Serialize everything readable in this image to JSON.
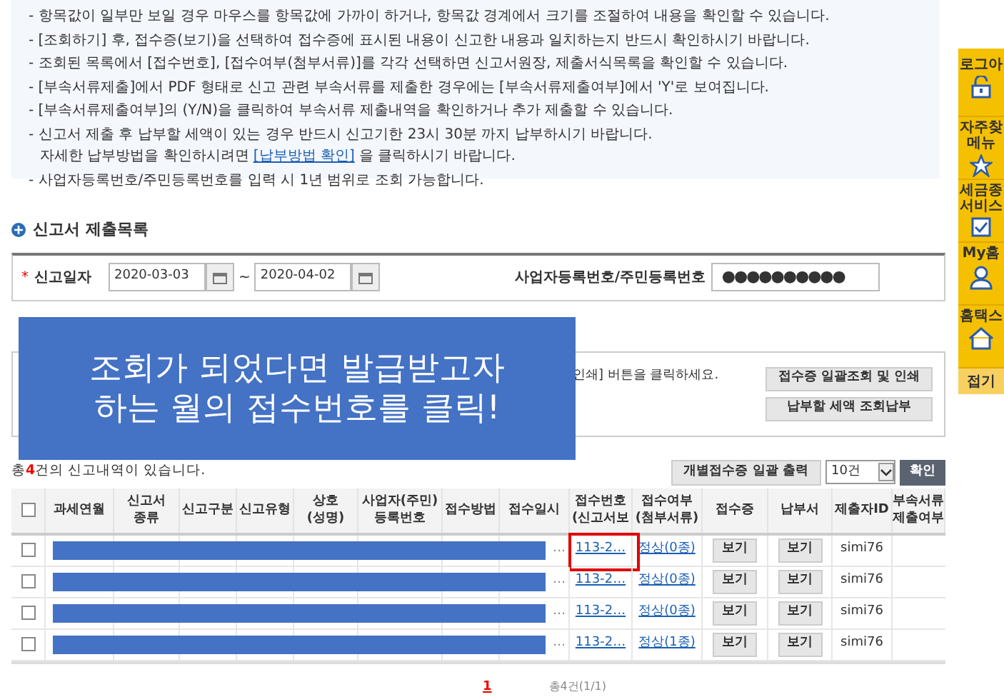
{
  "bullet": "-",
  "notes": [
    {
      "text": "항목값이 일부만 보일 경우 마우스를 항목값에 가까이 하거나, 항목값 경계에서 크기를 조절하여 내용을 확인할 수 있습니다."
    },
    {
      "text": "[조회하기] 후, 접수증(보기)을 선택하여 접수증에 표시된 내용이 신고한 내용과 일치하는지 반드시 확인하시기 바랍니다."
    },
    {
      "text": "조회된 목록에서 [접수번호], [접수여부(첨부서류)]를 각각 선택하면 신고서원장, 제출서식목록을 확인할 수 있습니다."
    },
    {
      "text": "[부속서류제출]에서 PDF 형태로 신고 관련 부속서류를 제출한 경우에는 [부속서류제출여부]에서 'Y'로 보여집니다."
    },
    {
      "text": "[부속서류제출여부]의 (Y/N)을 클릭하여 부속서류 제출내역을 확인하거나 추가 제출할 수 있습니다."
    },
    {
      "text": "신고서 제출 후 납부할 세액이 있는 경우 반드시 신고기한 23시 30분 까지 납부하시기 바랍니다.",
      "second_line": "자세한 납부방법을 확인하시려면",
      "link": "[납부방법 확인]",
      "after_link": "을 클릭하시기 바랍니다."
    },
    {
      "text": "사업자등록번호/주민등록번호를 입력 시 1년 범위로 조회 가능합니다."
    }
  ],
  "section_title": "신고서 제출목록",
  "search": {
    "required_mark": "*",
    "date_label": "신고일자",
    "date_from": "2020-03-03",
    "tilde": "~",
    "date_to": "2020-04-02",
    "id_label": "사업자등록번호/주민등록번호",
    "id_value": "●●●●●●●●●●"
  },
  "overlay": {
    "lines": [
      "조회가 되었다면 발급받고자",
      "하는 월의 접수번호를 클릭!"
    ]
  },
  "info": {
    "text": "인쇄] 버튼을 클릭하세요.",
    "buttons": [
      "접수증 일괄조회 및 인쇄",
      "납부할 세액 조회납부"
    ]
  },
  "summary": {
    "before": "총",
    "count": "4",
    "after": "건의 신고내역이 있습니다."
  },
  "toolbar": {
    "print_button": "개별접수증 일괄 출력",
    "page_size": "10건",
    "confirm_button": "확인"
  },
  "table": {
    "select_all_checked": false,
    "columns": [
      [
        "과세연월"
      ],
      [
        "신고서",
        "종류"
      ],
      [
        "신고구분"
      ],
      [
        "신고유형"
      ],
      [
        "상호",
        "(성명)"
      ],
      [
        "사업자(주민)",
        "등록번호"
      ],
      [
        "접수방법"
      ],
      [
        "접수일시"
      ],
      [
        "접수번호",
        "(신고서보"
      ],
      [
        "접수여부",
        "(첨부서류)"
      ],
      [
        "접수증"
      ],
      [
        "납부서"
      ],
      [
        "제출자ID"
      ],
      [
        "부속서류",
        "제출여부"
      ]
    ],
    "rows": [
      {
        "checked": false,
        "time_tail": "…",
        "receipt_no": "113-2…",
        "status": "정상(0종)",
        "receipt_button": "보기",
        "payment_button": "보기",
        "submitter": "simi76",
        "highlighted": true
      },
      {
        "checked": false,
        "time_tail": "…",
        "receipt_no": "113-2…",
        "status": "정상(0종)",
        "receipt_button": "보기",
        "payment_button": "보기",
        "submitter": "simi76",
        "highlighted": false
      },
      {
        "checked": false,
        "time_tail": "…",
        "receipt_no": "113-2…",
        "status": "정상(0종)",
        "receipt_button": "보기",
        "payment_button": "보기",
        "submitter": "simi76",
        "highlighted": false
      },
      {
        "checked": false,
        "time_tail": "…",
        "receipt_no": "113-2…",
        "status": "정상(1종)",
        "receipt_button": "보기",
        "payment_button": "보기",
        "submitter": "simi76",
        "highlighted": false
      }
    ]
  },
  "pagination": {
    "pages": [
      {
        "label": "1",
        "selected": true
      }
    ],
    "total": "총4건(1/1)"
  },
  "sidebar": {
    "items": [
      {
        "kind": "lock",
        "lines": [
          "로그아"
        ]
      },
      {
        "kind": "star",
        "lines": [
          "자주찾",
          "메뉴"
        ]
      },
      {
        "kind": "check",
        "lines": [
          "세금종",
          "서비스"
        ]
      },
      {
        "kind": "person",
        "lines": [
          "My홈"
        ]
      },
      {
        "kind": "home",
        "lines": [
          "홈택스"
        ]
      }
    ],
    "fold": "접기"
  }
}
